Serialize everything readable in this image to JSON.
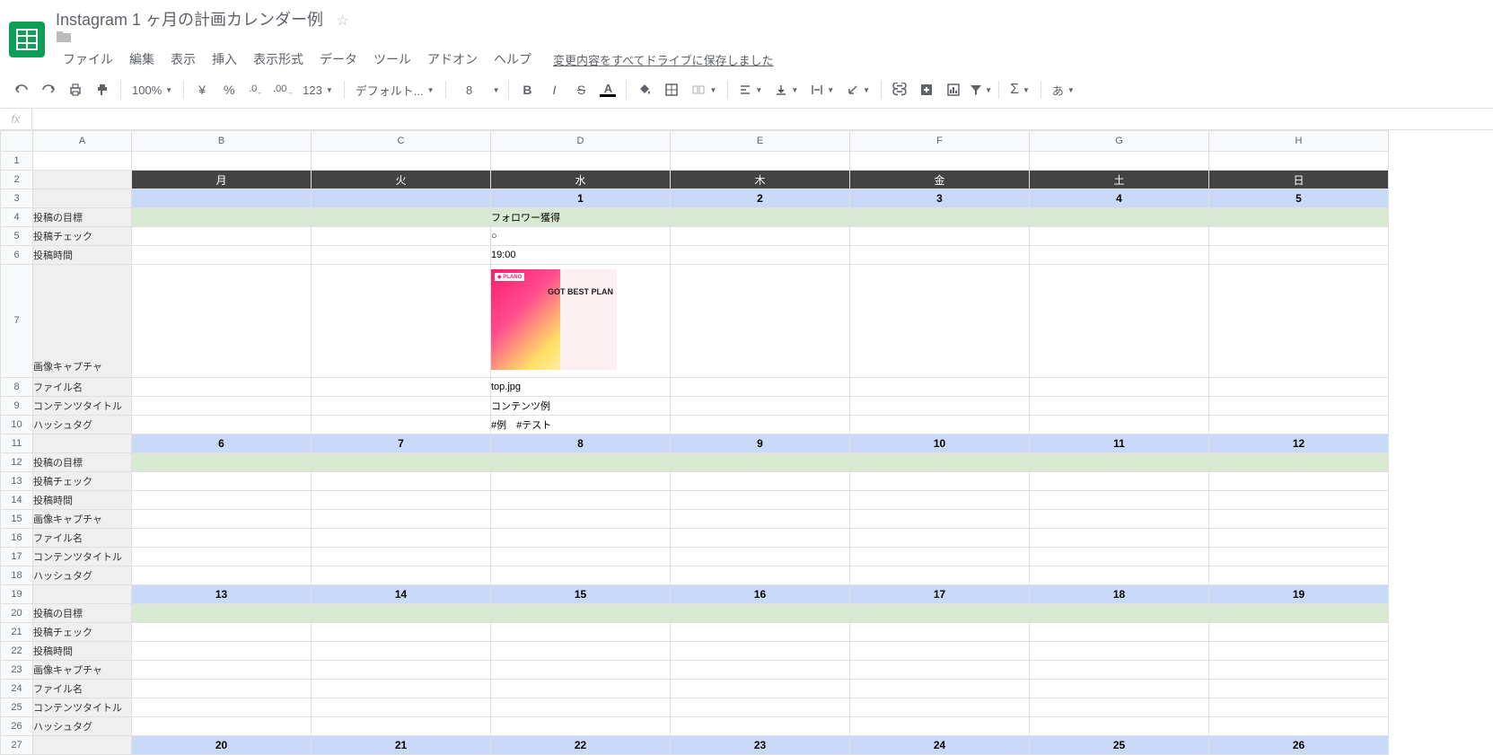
{
  "header": {
    "title": "Instagram 1 ヶ月の計画カレンダー例",
    "save_status": "変更内容をすべてドライブに保存しました"
  },
  "menus": [
    "ファイル",
    "編集",
    "表示",
    "挿入",
    "表示形式",
    "データ",
    "ツール",
    "アドオン",
    "ヘルプ"
  ],
  "toolbar": {
    "zoom": "100%",
    "currency": "¥",
    "percent": "%",
    "dec_minus": ".0",
    "dec_plus": ".00",
    "format_123": "123",
    "font": "デフォルト...",
    "font_size": "8",
    "ime": "あ"
  },
  "columns": [
    "A",
    "B",
    "C",
    "D",
    "E",
    "F",
    "G",
    "H"
  ],
  "row_labels": {
    "goal": "投稿の目標",
    "check": "投稿チェック",
    "time": "投稿時間",
    "capture": "画像キャプチャ",
    "filename": "ファイル名",
    "content_title": "コンテンツタイトル",
    "hashtag": "ハッシュタグ"
  },
  "week_header": [
    "月",
    "火",
    "水",
    "木",
    "金",
    "土",
    "日"
  ],
  "weeks": [
    {
      "days": [
        "",
        "",
        "1",
        "2",
        "3",
        "4",
        "5"
      ]
    },
    {
      "days": [
        "6",
        "7",
        "8",
        "9",
        "10",
        "11",
        "12"
      ]
    },
    {
      "days": [
        "13",
        "14",
        "15",
        "16",
        "17",
        "18",
        "19"
      ]
    },
    {
      "days": [
        "20",
        "21",
        "22",
        "23",
        "24",
        "25",
        "26"
      ]
    }
  ],
  "sample": {
    "goal": "フォロワー獲得",
    "check": "○",
    "time": "19:00",
    "filename": "top.jpg",
    "content_title": "コンテンツ例",
    "hashtag": "#例　#テスト",
    "thumb_text": "GOT BEST PLAN",
    "thumb_logo": "◆ PLANO"
  }
}
